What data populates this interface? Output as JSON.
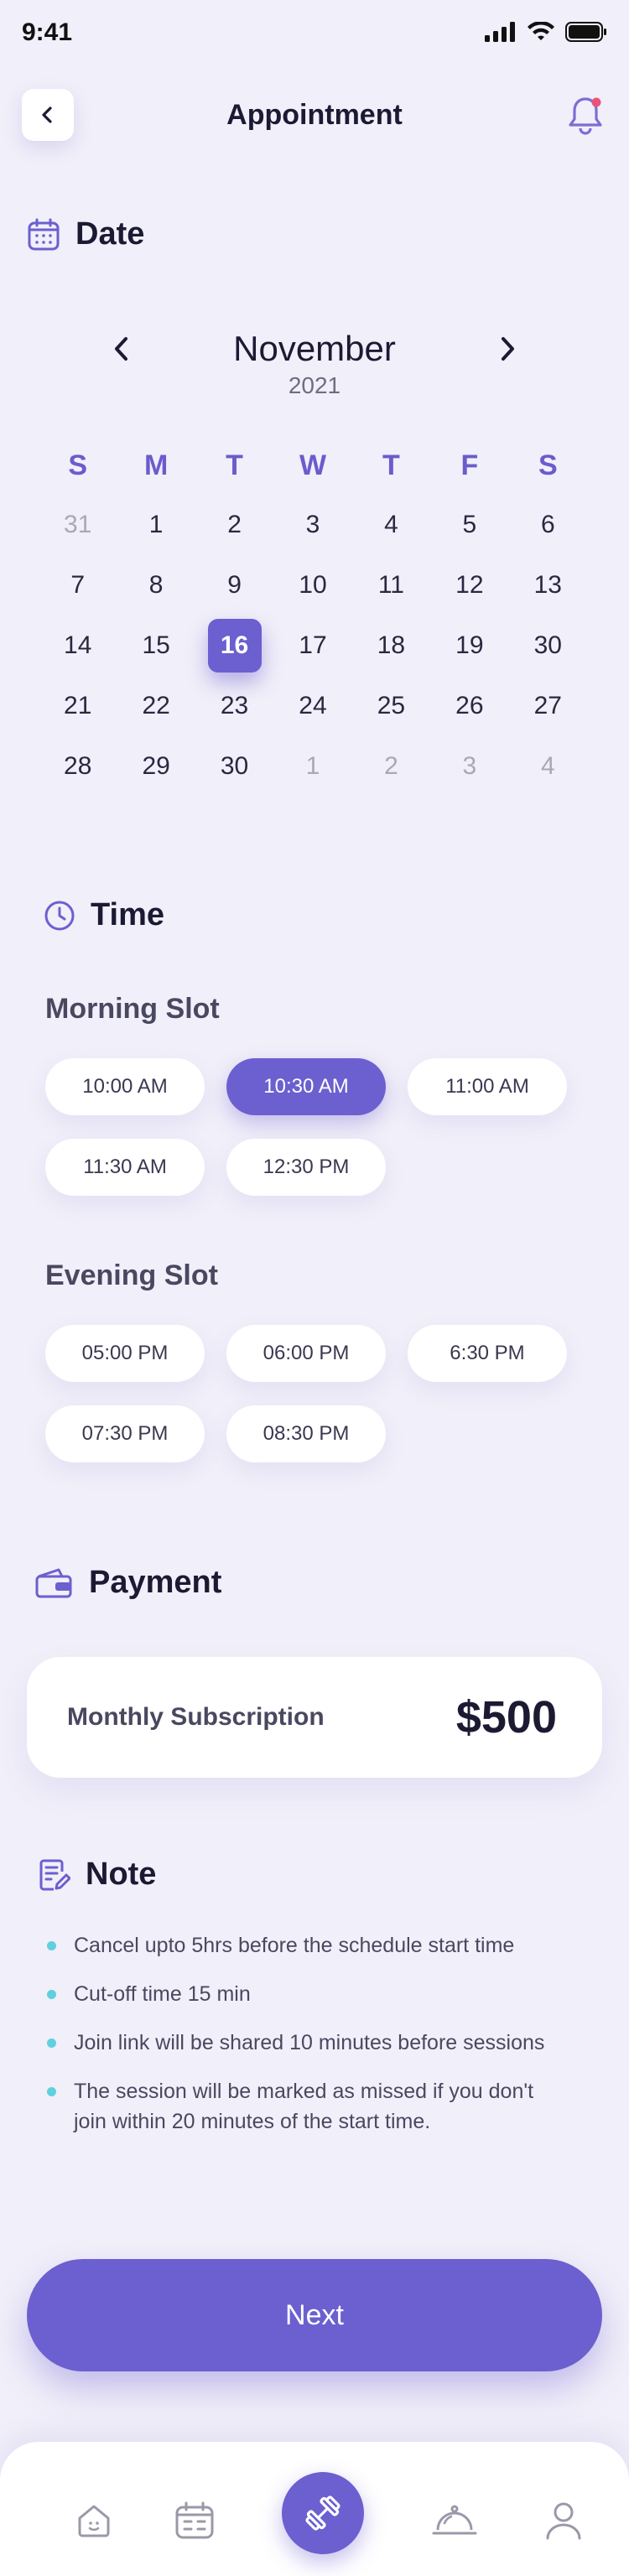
{
  "status_bar": {
    "time": "9:41"
  },
  "header": {
    "title": "Appointment"
  },
  "sections": {
    "date": "Date",
    "time": "Time",
    "payment": "Payment",
    "note": "Note"
  },
  "calendar": {
    "month": "November",
    "year": "2021",
    "weekdays": [
      "S",
      "M",
      "T",
      "W",
      "T",
      "F",
      "S"
    ],
    "selected_day": "16",
    "weeks": [
      [
        {
          "d": "31",
          "muted": true
        },
        {
          "d": "1"
        },
        {
          "d": "2"
        },
        {
          "d": "3"
        },
        {
          "d": "4"
        },
        {
          "d": "5"
        },
        {
          "d": "6"
        }
      ],
      [
        {
          "d": "7"
        },
        {
          "d": "8"
        },
        {
          "d": "9"
        },
        {
          "d": "10"
        },
        {
          "d": "11"
        },
        {
          "d": "12"
        },
        {
          "d": "13"
        }
      ],
      [
        {
          "d": "14"
        },
        {
          "d": "15"
        },
        {
          "d": "16",
          "selected": true
        },
        {
          "d": "17"
        },
        {
          "d": "18"
        },
        {
          "d": "19"
        },
        {
          "d": "30"
        }
      ],
      [
        {
          "d": "21"
        },
        {
          "d": "22"
        },
        {
          "d": "23"
        },
        {
          "d": "24"
        },
        {
          "d": "25"
        },
        {
          "d": "26"
        },
        {
          "d": "27"
        }
      ],
      [
        {
          "d": "28"
        },
        {
          "d": "29"
        },
        {
          "d": "30"
        },
        {
          "d": "1",
          "muted": true
        },
        {
          "d": "2",
          "muted": true
        },
        {
          "d": "3",
          "muted": true
        },
        {
          "d": "4",
          "muted": true
        }
      ]
    ]
  },
  "morning": {
    "label": "Morning Slot",
    "slots": [
      "10:00 AM",
      "10:30 AM",
      "11:00 AM",
      "11:30 AM",
      "12:30 PM"
    ],
    "selected": "10:30 AM"
  },
  "evening": {
    "label": "Evening Slot",
    "slots": [
      "05:00 PM",
      "06:00 PM",
      "6:30 PM",
      "07:30 PM",
      "08:30 PM"
    ]
  },
  "payment": {
    "label": "Monthly Subscription",
    "price": "$500"
  },
  "notes": [
    "Cancel upto 5hrs before the schedule start time",
    "Cut-off time 15 min",
    "Join link will be shared 10 minutes before sessions",
    "The session will be marked as missed if you don't join within 20 minutes of the start time."
  ],
  "next_button": "Next",
  "colors": {
    "accent": "#6c5fd0",
    "background": "#f1eff9",
    "bullet": "#5fd0de",
    "notification_dot": "#e8537a"
  },
  "icons": {
    "back": "chevron-left-icon",
    "notification": "bell-icon",
    "date": "calendar-icon",
    "time": "clock-icon",
    "payment": "wallet-icon",
    "note": "note-icon",
    "nav": [
      "home-icon",
      "calendar-icon",
      "dumbbell-icon",
      "cloche-icon",
      "profile-icon"
    ]
  }
}
